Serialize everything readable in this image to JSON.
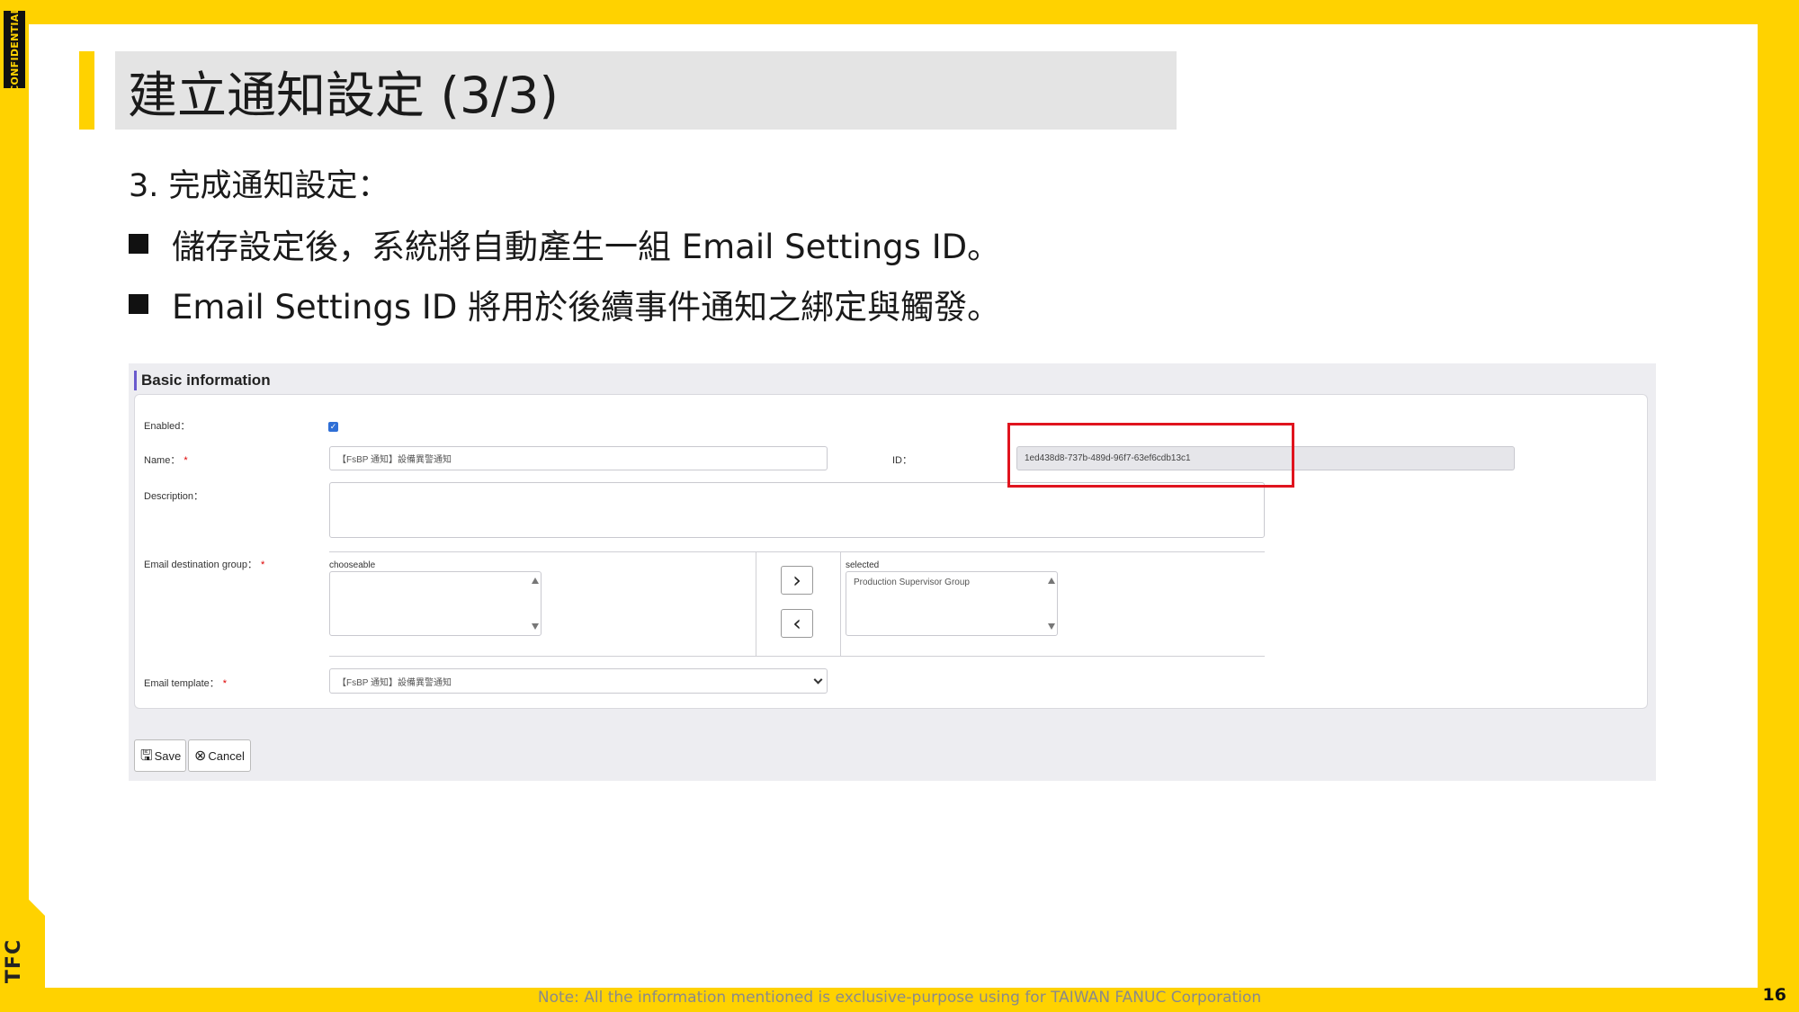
{
  "branding": {
    "confidential": "CONFIDENTIAL",
    "logo": "TFC",
    "footer_note": "Note: All the information mentioned is exclusive-purpose using for TAIWAN FANUC Corporation",
    "page_number": "16",
    "accent_color": "#FFD200"
  },
  "slide": {
    "title": "建立通知設定 (3/3)",
    "step": "3. 完成通知設定：",
    "bullets": [
      "儲存設定後，系統將自動產生一組 Email Settings ID。",
      "Email Settings ID 將用於後續事件通知之綁定與觸發。"
    ]
  },
  "form": {
    "section_title": "Basic information",
    "enabled_label": "Enabled：",
    "enabled_checked": true,
    "name_label": "Name：",
    "name_value": "【FsBP 通知】設備異警通知",
    "id_label": "ID：",
    "id_value": "1ed438d8-737b-489d-96f7-63ef6cdb13c1",
    "description_label": "Description：",
    "description_value": "",
    "email_group_label": "Email destination group：",
    "chooseable_label": "chooseable",
    "selected_label": "selected",
    "selected_items": [
      "Production Supervisor Group"
    ],
    "move_right": "›",
    "move_left": "‹",
    "email_template_label": "Email template：",
    "email_template_value": "【FsBP 通知】設備異警通知",
    "required_mark": "*",
    "save_label": "Save",
    "cancel_label": "Cancel",
    "highlight_color": "#E0141E"
  }
}
